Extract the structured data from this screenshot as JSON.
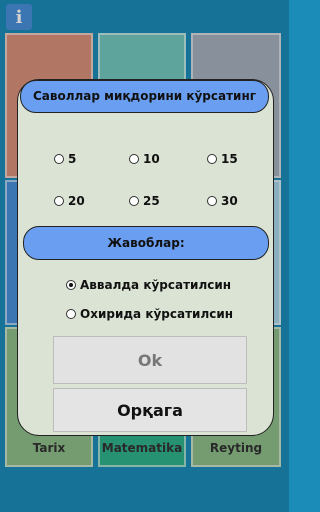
{
  "info_icon_glyph": "i",
  "tiles": [
    {
      "label": "Tarix",
      "color": "#8fbf8a"
    },
    {
      "label": "Matematika",
      "color": "#2fb38c"
    },
    {
      "label": "Reyting",
      "color": "#8fbf8a"
    }
  ],
  "dialog": {
    "title": "Саволлар миқдорини кўрсатинг",
    "counts": [
      "5",
      "10",
      "15",
      "20",
      "25",
      "30"
    ],
    "answers_header": "Жавоблар:",
    "answer_options": [
      "Аввалда кўрсатилсин",
      "Охирида кўрсатилсин"
    ],
    "selected_answer_index": 0,
    "ok_label": "Ok",
    "back_label": "Орқага"
  }
}
